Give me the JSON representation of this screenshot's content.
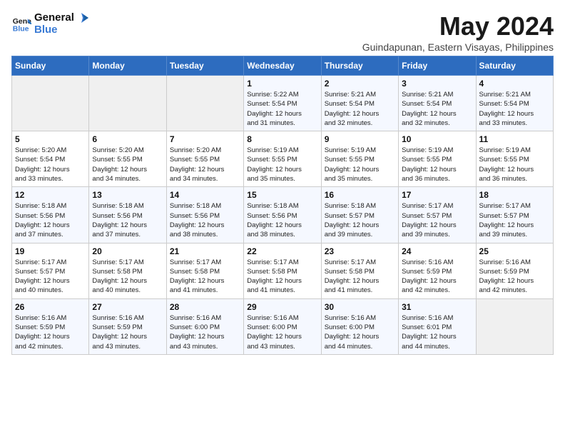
{
  "header": {
    "logo_line1": "General",
    "logo_line2": "Blue",
    "month": "May 2024",
    "location": "Guindapunan, Eastern Visayas, Philippines"
  },
  "weekdays": [
    "Sunday",
    "Monday",
    "Tuesday",
    "Wednesday",
    "Thursday",
    "Friday",
    "Saturday"
  ],
  "weeks": [
    [
      {
        "day": "",
        "info": ""
      },
      {
        "day": "",
        "info": ""
      },
      {
        "day": "",
        "info": ""
      },
      {
        "day": "1",
        "info": "Sunrise: 5:22 AM\nSunset: 5:54 PM\nDaylight: 12 hours\nand 31 minutes."
      },
      {
        "day": "2",
        "info": "Sunrise: 5:21 AM\nSunset: 5:54 PM\nDaylight: 12 hours\nand 32 minutes."
      },
      {
        "day": "3",
        "info": "Sunrise: 5:21 AM\nSunset: 5:54 PM\nDaylight: 12 hours\nand 32 minutes."
      },
      {
        "day": "4",
        "info": "Sunrise: 5:21 AM\nSunset: 5:54 PM\nDaylight: 12 hours\nand 33 minutes."
      }
    ],
    [
      {
        "day": "5",
        "info": "Sunrise: 5:20 AM\nSunset: 5:54 PM\nDaylight: 12 hours\nand 33 minutes."
      },
      {
        "day": "6",
        "info": "Sunrise: 5:20 AM\nSunset: 5:55 PM\nDaylight: 12 hours\nand 34 minutes."
      },
      {
        "day": "7",
        "info": "Sunrise: 5:20 AM\nSunset: 5:55 PM\nDaylight: 12 hours\nand 34 minutes."
      },
      {
        "day": "8",
        "info": "Sunrise: 5:19 AM\nSunset: 5:55 PM\nDaylight: 12 hours\nand 35 minutes."
      },
      {
        "day": "9",
        "info": "Sunrise: 5:19 AM\nSunset: 5:55 PM\nDaylight: 12 hours\nand 35 minutes."
      },
      {
        "day": "10",
        "info": "Sunrise: 5:19 AM\nSunset: 5:55 PM\nDaylight: 12 hours\nand 36 minutes."
      },
      {
        "day": "11",
        "info": "Sunrise: 5:19 AM\nSunset: 5:55 PM\nDaylight: 12 hours\nand 36 minutes."
      }
    ],
    [
      {
        "day": "12",
        "info": "Sunrise: 5:18 AM\nSunset: 5:56 PM\nDaylight: 12 hours\nand 37 minutes."
      },
      {
        "day": "13",
        "info": "Sunrise: 5:18 AM\nSunset: 5:56 PM\nDaylight: 12 hours\nand 37 minutes."
      },
      {
        "day": "14",
        "info": "Sunrise: 5:18 AM\nSunset: 5:56 PM\nDaylight: 12 hours\nand 38 minutes."
      },
      {
        "day": "15",
        "info": "Sunrise: 5:18 AM\nSunset: 5:56 PM\nDaylight: 12 hours\nand 38 minutes."
      },
      {
        "day": "16",
        "info": "Sunrise: 5:18 AM\nSunset: 5:57 PM\nDaylight: 12 hours\nand 39 minutes."
      },
      {
        "day": "17",
        "info": "Sunrise: 5:17 AM\nSunset: 5:57 PM\nDaylight: 12 hours\nand 39 minutes."
      },
      {
        "day": "18",
        "info": "Sunrise: 5:17 AM\nSunset: 5:57 PM\nDaylight: 12 hours\nand 39 minutes."
      }
    ],
    [
      {
        "day": "19",
        "info": "Sunrise: 5:17 AM\nSunset: 5:57 PM\nDaylight: 12 hours\nand 40 minutes."
      },
      {
        "day": "20",
        "info": "Sunrise: 5:17 AM\nSunset: 5:58 PM\nDaylight: 12 hours\nand 40 minutes."
      },
      {
        "day": "21",
        "info": "Sunrise: 5:17 AM\nSunset: 5:58 PM\nDaylight: 12 hours\nand 41 minutes."
      },
      {
        "day": "22",
        "info": "Sunrise: 5:17 AM\nSunset: 5:58 PM\nDaylight: 12 hours\nand 41 minutes."
      },
      {
        "day": "23",
        "info": "Sunrise: 5:17 AM\nSunset: 5:58 PM\nDaylight: 12 hours\nand 41 minutes."
      },
      {
        "day": "24",
        "info": "Sunrise: 5:16 AM\nSunset: 5:59 PM\nDaylight: 12 hours\nand 42 minutes."
      },
      {
        "day": "25",
        "info": "Sunrise: 5:16 AM\nSunset: 5:59 PM\nDaylight: 12 hours\nand 42 minutes."
      }
    ],
    [
      {
        "day": "26",
        "info": "Sunrise: 5:16 AM\nSunset: 5:59 PM\nDaylight: 12 hours\nand 42 minutes."
      },
      {
        "day": "27",
        "info": "Sunrise: 5:16 AM\nSunset: 5:59 PM\nDaylight: 12 hours\nand 43 minutes."
      },
      {
        "day": "28",
        "info": "Sunrise: 5:16 AM\nSunset: 6:00 PM\nDaylight: 12 hours\nand 43 minutes."
      },
      {
        "day": "29",
        "info": "Sunrise: 5:16 AM\nSunset: 6:00 PM\nDaylight: 12 hours\nand 43 minutes."
      },
      {
        "day": "30",
        "info": "Sunrise: 5:16 AM\nSunset: 6:00 PM\nDaylight: 12 hours\nand 44 minutes."
      },
      {
        "day": "31",
        "info": "Sunrise: 5:16 AM\nSunset: 6:01 PM\nDaylight: 12 hours\nand 44 minutes."
      },
      {
        "day": "",
        "info": ""
      }
    ]
  ]
}
